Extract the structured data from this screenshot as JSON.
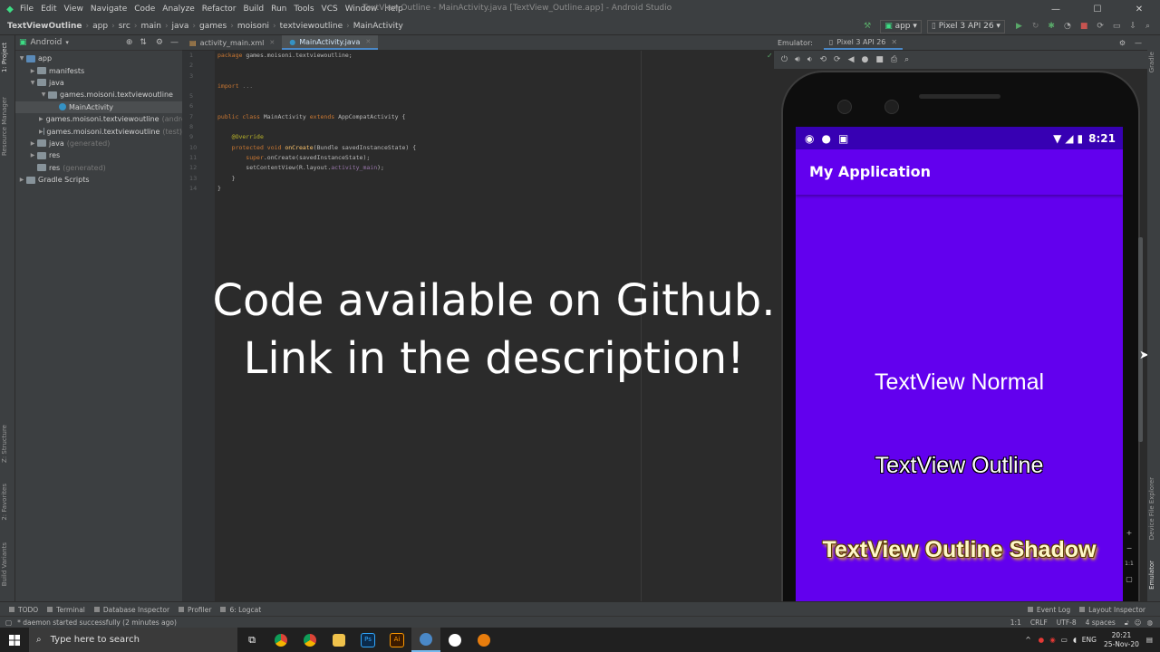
{
  "window": {
    "title": "TextView Outline - MainActivity.java [TextView_Outline.app] - Android Studio",
    "menu": [
      "File",
      "Edit",
      "View",
      "Navigate",
      "Code",
      "Analyze",
      "Refactor",
      "Build",
      "Run",
      "Tools",
      "VCS",
      "Window",
      "Help"
    ]
  },
  "breadcrumbs": [
    "TextViewOutline",
    "app",
    "src",
    "main",
    "java",
    "games",
    "moisoni",
    "textviewoutline",
    "MainActivity"
  ],
  "toolbar": {
    "run_config": "app",
    "device": "Pixel 3 API 26"
  },
  "project_panel": {
    "view_label": "Android",
    "tree": [
      {
        "label": "app",
        "muted": "",
        "indent": 0,
        "arrow": "▼",
        "icon": "folder-blue"
      },
      {
        "label": "manifests",
        "muted": "",
        "indent": 1,
        "arrow": "▶",
        "icon": "folder"
      },
      {
        "label": "java",
        "muted": "",
        "indent": 1,
        "arrow": "▼",
        "icon": "folder"
      },
      {
        "label": "games.moisoni.textviewoutline",
        "muted": "",
        "indent": 2,
        "arrow": "▼",
        "icon": "folder"
      },
      {
        "label": "MainActivity",
        "muted": "",
        "indent": 3,
        "arrow": "",
        "icon": "class",
        "selected": true
      },
      {
        "label": "games.moisoni.textviewoutline",
        "muted": "(andro",
        "indent": 2,
        "arrow": "▶",
        "icon": "folder"
      },
      {
        "label": "games.moisoni.textviewoutline",
        "muted": "(test)",
        "indent": 2,
        "arrow": "▶",
        "icon": "folder"
      },
      {
        "label": "java",
        "muted": "(generated)",
        "indent": 1,
        "arrow": "▶",
        "icon": "folder"
      },
      {
        "label": "res",
        "muted": "",
        "indent": 1,
        "arrow": "▶",
        "icon": "folder"
      },
      {
        "label": "res",
        "muted": "(generated)",
        "indent": 1,
        "arrow": "",
        "icon": "folder"
      },
      {
        "label": "Gradle Scripts",
        "muted": "",
        "indent": 0,
        "arrow": "▶",
        "icon": "folder"
      }
    ]
  },
  "left_strip": [
    "1: Project",
    "Resource Manager",
    "Z: Structure",
    "2: Favorites",
    "Build Variants"
  ],
  "editor": {
    "tabs": [
      "activity_main.xml",
      "MainActivity.java"
    ],
    "active_tab": 1,
    "line_numbers": [
      "1",
      "2",
      "3",
      "",
      "5",
      "6",
      "7",
      "8",
      "9",
      "10",
      "11",
      "12",
      "13",
      "14"
    ],
    "code_lines": [
      [
        {
          "t": "package ",
          "c": "kw"
        },
        {
          "t": "games.moisoni.textviewoutline;",
          "c": ""
        }
      ],
      [],
      [
        {
          "t": "import ",
          "c": "kw"
        },
        {
          "t": "...",
          "c": "mu"
        }
      ],
      [],
      [
        {
          "t": "public class ",
          "c": "kw"
        },
        {
          "t": "MainActivity ",
          "c": ""
        },
        {
          "t": "extends ",
          "c": "kw"
        },
        {
          "t": "AppCompatActivity {",
          "c": ""
        }
      ],
      [],
      [
        {
          "t": "    @Override",
          "c": "an"
        }
      ],
      [
        {
          "t": "    protected void ",
          "c": "kw"
        },
        {
          "t": "onCreate",
          "c": "fn"
        },
        {
          "t": "(Bundle savedInstanceState) {",
          "c": ""
        }
      ],
      [
        {
          "t": "        super",
          "c": "kw"
        },
        {
          "t": ".onCreate(savedInstanceState);",
          "c": ""
        }
      ],
      [
        {
          "t": "        setContentView(R.layout.",
          "c": ""
        },
        {
          "t": "activity_main",
          "c": "pu"
        },
        {
          "t": ");",
          "c": ""
        }
      ],
      [
        {
          "t": "    }",
          "c": ""
        }
      ],
      [
        {
          "t": "}",
          "c": ""
        }
      ]
    ]
  },
  "caption": {
    "line1": "Code available on Github.",
    "line2": "Link in the description!"
  },
  "emulator": {
    "label": "Emulator:",
    "device_tab": "Pixel 3 API 26",
    "time": "8:21",
    "app_title": "My Application",
    "text_normal": "TextView Normal",
    "text_outline": "TextView Outline",
    "text_shadow": "TextView Outline Shadow",
    "screen_color": "#6200ee",
    "status_color": "#3700b3"
  },
  "right_strip": [
    "Gradle",
    "Device File Explorer",
    "Emulator"
  ],
  "bottom_tools": [
    "TODO",
    "Terminal",
    "Database Inspector",
    "Profiler",
    "6: Logcat"
  ],
  "bottom_right_tools": [
    "Event Log",
    "Layout Inspector"
  ],
  "status": {
    "message": "daemon started successfully (2 minutes ago)",
    "position": "1:1",
    "line_sep": "CRLF",
    "encoding": "UTF-8",
    "indent": "4 spaces"
  },
  "taskbar": {
    "search_placeholder": "Type here to search",
    "lang": "ENG",
    "time": "20:21",
    "date": "25-Nov-20"
  }
}
